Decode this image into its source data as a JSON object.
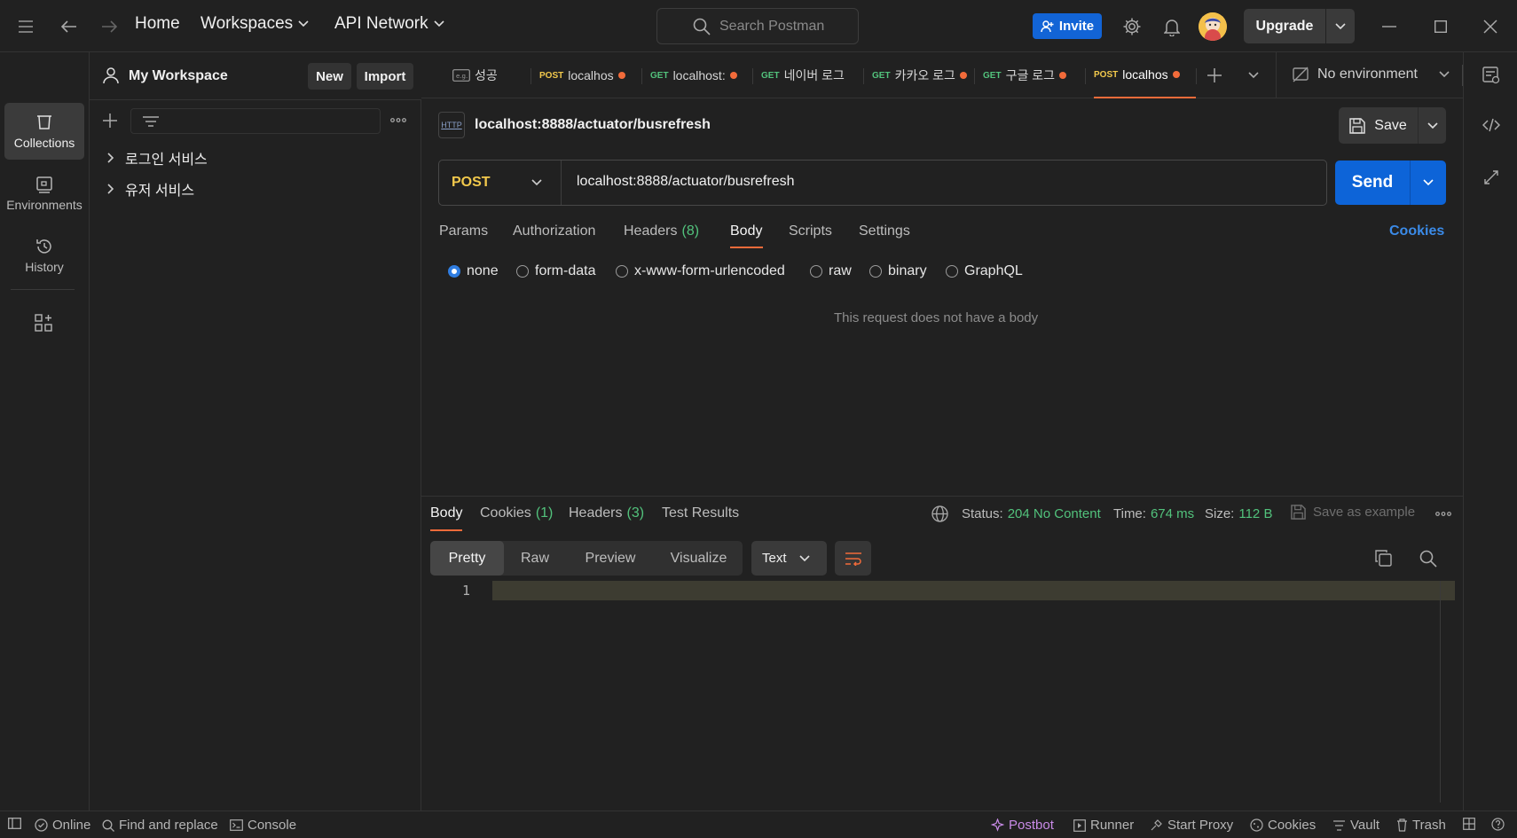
{
  "titlebar": {
    "home": "Home",
    "workspaces": "Workspaces",
    "api_network": "API Network",
    "search_placeholder": "Search Postman",
    "invite": "Invite",
    "upgrade": "Upgrade"
  },
  "workspace": {
    "name": "My Workspace",
    "new_label": "New",
    "import_label": "Import"
  },
  "rail": {
    "items": [
      {
        "label": "Collections"
      },
      {
        "label": "Environments"
      },
      {
        "label": "History"
      }
    ]
  },
  "collections": [
    {
      "name": "로그인 서비스"
    },
    {
      "name": "유저 서비스"
    }
  ],
  "tabs": [
    {
      "method": "",
      "label": "성공",
      "dirty": false
    },
    {
      "method": "POST",
      "label": "localhos",
      "dirty": true
    },
    {
      "method": "GET",
      "label": "localhost:",
      "dirty": true
    },
    {
      "method": "GET",
      "label": "네이버 로그",
      "dirty": false
    },
    {
      "method": "GET",
      "label": "카카오 로그",
      "dirty": true
    },
    {
      "method": "GET",
      "label": "구글 로그",
      "dirty": true
    },
    {
      "method": "POST",
      "label": "localhos",
      "dirty": true
    }
  ],
  "environment": "No environment",
  "request": {
    "title": "localhost:8888/actuator/busrefresh",
    "http_badge": "HTTP",
    "method": "POST",
    "url": "localhost:8888/actuator/busrefresh",
    "send": "Send",
    "save": "Save",
    "tabs": {
      "params": "Params",
      "authorization": "Authorization",
      "headers": "Headers",
      "headers_count": "(8)",
      "body": "Body",
      "scripts": "Scripts",
      "settings": "Settings"
    },
    "cookies": "Cookies",
    "body_types": [
      "none",
      "form-data",
      "x-www-form-urlencoded",
      "raw",
      "binary",
      "GraphQL"
    ],
    "no_body": "This request does not have a body"
  },
  "response": {
    "tabs": {
      "body": "Body",
      "cookies": "Cookies",
      "cookies_count": "(1)",
      "headers": "Headers",
      "headers_count": "(3)",
      "test_results": "Test Results"
    },
    "status_label": "Status:",
    "status_value": "204 No Content",
    "time_label": "Time:",
    "time_value": "674 ms",
    "size_label": "Size:",
    "size_value": "112 B",
    "save_example": "Save as example",
    "views": [
      "Pretty",
      "Raw",
      "Preview",
      "Visualize"
    ],
    "format": "Text",
    "line_number": "1"
  },
  "statusbar": {
    "online": "Online",
    "find_replace": "Find and replace",
    "console": "Console",
    "postbot": "Postbot",
    "runner": "Runner",
    "start_proxy": "Start Proxy",
    "cookies": "Cookies",
    "vault": "Vault",
    "trash": "Trash"
  },
  "colors": {
    "accent_orange": "#f26b3a",
    "primary_blue": "#0d64d8",
    "status_green": "#52c27c",
    "method_post": "#f2c94c",
    "method_get": "#52c27c"
  }
}
